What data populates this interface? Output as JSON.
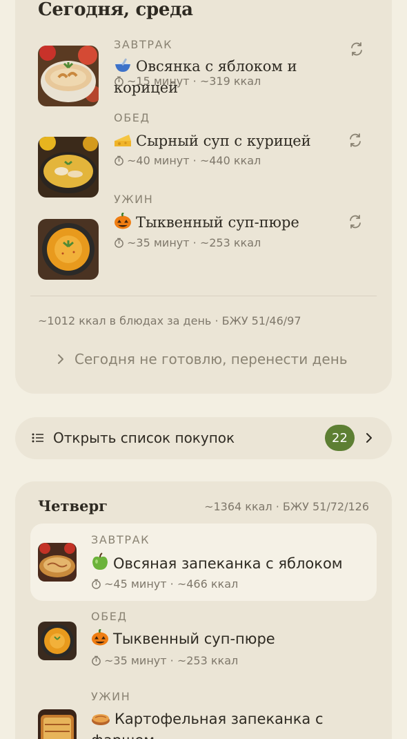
{
  "today": {
    "title": "Сегодня, среда",
    "meals": [
      {
        "type": "ЗАВТРАК",
        "name": "Овсянка с яблоком и корицей",
        "meta": "~15 минут · ~319 ккал",
        "icon": "porridge-bowl-icon"
      },
      {
        "type": "ОБЕД",
        "name": "Сырный суп с курицей",
        "meta": "~40 минут · ~440 ккал",
        "icon": "cheese-icon"
      },
      {
        "type": "УЖИН",
        "name": "Тыквенный суп-пюре",
        "meta": "~35 минут · ~253 ккал",
        "icon": "pumpkin-icon"
      }
    ],
    "summary": "~1012 ккал в блюдах за день · БЖУ 51/46/97",
    "skip_label": "Сегодня не готовлю, перенести день"
  },
  "shopping": {
    "label": "Открыть список покупок",
    "count": "22"
  },
  "thursday": {
    "title": "Четверг",
    "summary": "~1364 ккал · БЖУ 51/72/126",
    "meals": [
      {
        "type": "ЗАВТРАК",
        "name": "Овсяная запеканка с яблоком",
        "meta": "~45 минут · ~466 ккал",
        "icon": "green-apple-icon"
      },
      {
        "type": "ОБЕД",
        "name": "Тыквенный суп-пюре",
        "meta": "~35 минут · ~253 ккал",
        "icon": "pumpkin-icon"
      },
      {
        "type": "УЖИН",
        "name": "Картофельная запеканка с фаршем",
        "meta": "",
        "icon": "pie-icon"
      }
    ]
  },
  "colors": {
    "background": "#f3efe2",
    "card": "#ebe5d6",
    "accent": "#5d7f33"
  }
}
